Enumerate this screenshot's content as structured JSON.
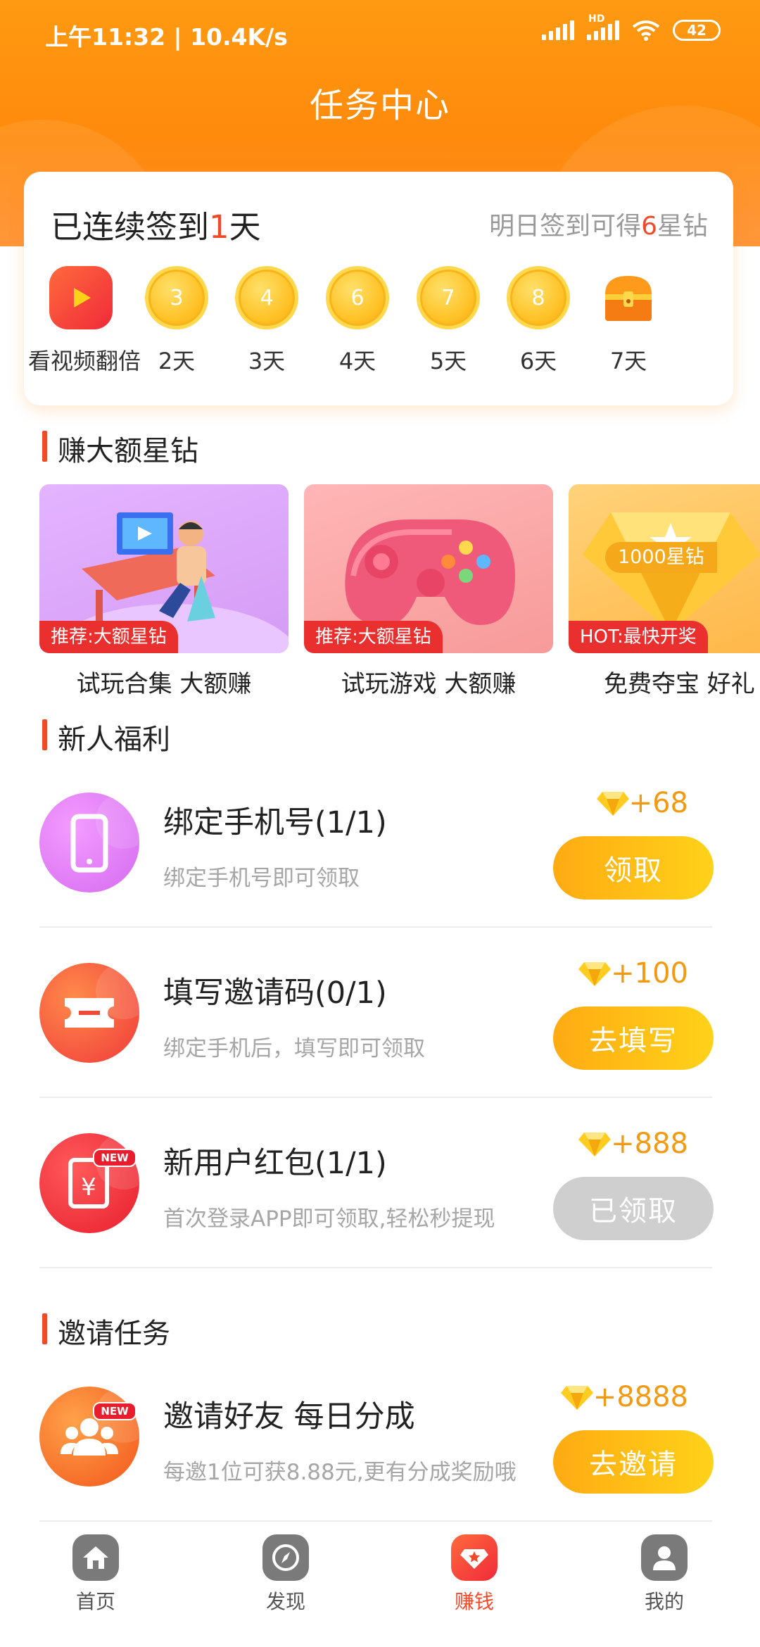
{
  "status_bar": {
    "time": "上午11:32 | 10.4K/s",
    "battery": "42",
    "hd": "HD"
  },
  "header": {
    "title": "任务中心"
  },
  "sign_in": {
    "prefix": "已连续签到",
    "days": "1",
    "suffix": "天",
    "tip_prefix": "明日签到可得",
    "tip_amount": "6",
    "tip_suffix": "星钻",
    "items": [
      {
        "label": "看视频翻倍",
        "icon": "play-video-icon"
      },
      {
        "value": "3",
        "label": "2天"
      },
      {
        "value": "4",
        "label": "3天"
      },
      {
        "value": "6",
        "label": "4天"
      },
      {
        "value": "7",
        "label": "5天"
      },
      {
        "value": "8",
        "label": "6天"
      },
      {
        "label": "7天",
        "icon": "treasure-chest-icon"
      }
    ]
  },
  "earn_section": {
    "title": "赚大额星钻",
    "cards": [
      {
        "tag": "推荐:大额星钻",
        "label": "试玩合集 大额赚"
      },
      {
        "tag": "推荐:大额星钻",
        "label": "试玩游戏 大额赚"
      },
      {
        "tag": "HOT:最快开奖",
        "label": "免费夺宝 好礼",
        "banner": "1000星钻"
      }
    ]
  },
  "newbie_section": {
    "title": "新人福利",
    "tasks": [
      {
        "name": "绑定手机号(1/1)",
        "desc": "绑定手机号即可领取",
        "reward": "+68",
        "button": "领取"
      },
      {
        "name": "填写邀请码(0/1)",
        "desc": "绑定手机后，填写即可领取",
        "reward": "+100",
        "button": "去填写"
      },
      {
        "name": "新用户红包(1/1)",
        "desc": "首次登录APP即可领取,轻松秒提现",
        "reward": "+888",
        "button": "已领取",
        "badge": "NEW"
      }
    ]
  },
  "invite_section": {
    "title": "邀请任务",
    "tasks": [
      {
        "name": "邀请好友 每日分成",
        "desc": "每邀1位可获8.88元,更有分成奖励哦",
        "reward": "+8888",
        "button": "去邀请",
        "badge": "NEW"
      }
    ]
  },
  "bottom_nav": [
    {
      "label": "首页",
      "icon": "home-icon"
    },
    {
      "label": "发现",
      "icon": "compass-icon"
    },
    {
      "label": "赚钱",
      "icon": "earn-icon",
      "active": true
    },
    {
      "label": "我的",
      "icon": "profile-icon"
    }
  ],
  "colors": {
    "brand_orange": "#ff8c0c",
    "accent_red": "#f04a2b",
    "reward_gold": "#f19a12"
  }
}
